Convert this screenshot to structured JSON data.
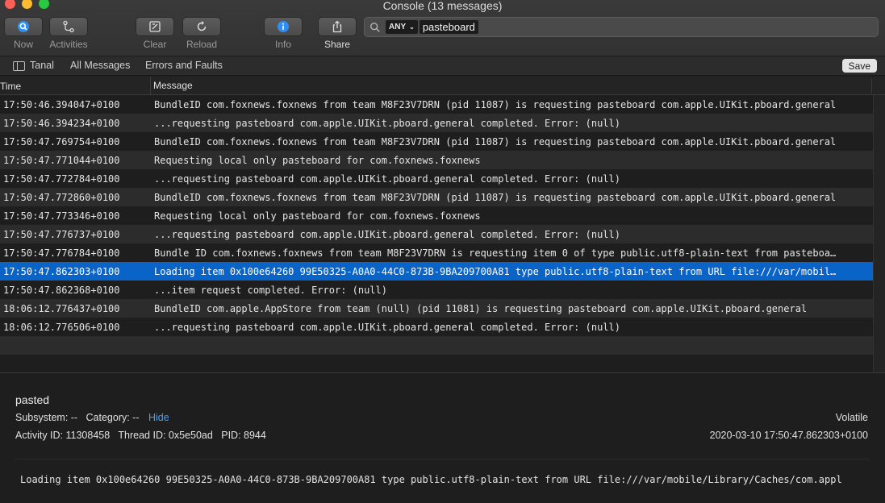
{
  "window": {
    "title": "Console (13 messages)"
  },
  "toolbar": {
    "now_label": "Now",
    "activities_label": "Activities",
    "clear_label": "Clear",
    "reload_label": "Reload",
    "info_label": "Info",
    "share_label": "Share"
  },
  "search": {
    "scope": "ANY",
    "token": "pasteboard"
  },
  "filterbar": {
    "sidebar_label": "Tanal",
    "all_messages": "All Messages",
    "errors_faults": "Errors and Faults",
    "save_label": "Save"
  },
  "table": {
    "col_time": "Time",
    "col_message": "Message",
    "rows": [
      {
        "time": "17:50:46.394047+0100",
        "message": "BundleID com.foxnews.foxnews from team M8F23V7DRN (pid 11087) is requesting pasteboard com.apple.UIKit.pboard.general"
      },
      {
        "time": "17:50:46.394234+0100",
        "message": "...requesting pasteboard com.apple.UIKit.pboard.general completed. Error: (null)"
      },
      {
        "time": "17:50:47.769754+0100",
        "message": "BundleID com.foxnews.foxnews from team M8F23V7DRN (pid 11087) is requesting pasteboard com.apple.UIKit.pboard.general"
      },
      {
        "time": "17:50:47.771044+0100",
        "message": "Requesting local only pasteboard for com.foxnews.foxnews"
      },
      {
        "time": "17:50:47.772784+0100",
        "message": "...requesting pasteboard com.apple.UIKit.pboard.general completed. Error: (null)"
      },
      {
        "time": "17:50:47.772860+0100",
        "message": "BundleID com.foxnews.foxnews from team M8F23V7DRN (pid 11087) is requesting pasteboard com.apple.UIKit.pboard.general"
      },
      {
        "time": "17:50:47.773346+0100",
        "message": "Requesting local only pasteboard for com.foxnews.foxnews"
      },
      {
        "time": "17:50:47.776737+0100",
        "message": "...requesting pasteboard com.apple.UIKit.pboard.general completed. Error: (null)"
      },
      {
        "time": "17:50:47.776784+0100",
        "message": "Bundle ID com.foxnews.foxnews from team M8F23V7DRN is requesting item 0 of type public.utf8-plain-text from pasteboa…"
      },
      {
        "time": "17:50:47.862303+0100",
        "message": "Loading item 0x100e64260 99E50325-A0A0-44C0-873B-9BA209700A81 type public.utf8-plain-text from URL file:///var/mobil…",
        "selected": true
      },
      {
        "time": "17:50:47.862368+0100",
        "message": "...item request completed. Error: (null)"
      },
      {
        "time": "18:06:12.776437+0100",
        "message": "BundleID com.apple.AppStore from team (null) (pid 11081) is requesting pasteboard com.apple.UIKit.pboard.general"
      },
      {
        "time": "18:06:12.776506+0100",
        "message": "...requesting pasteboard com.apple.UIKit.pboard.general completed. Error: (null)"
      }
    ]
  },
  "detail": {
    "process": "pasted",
    "subsystem_text": "Subsystem: --   Category: --",
    "hide_link": "Hide",
    "ids_text": "Activity ID: 11308458   Thread ID: 0x5e50ad   PID: 8944",
    "level": "Volatile",
    "timestamp": "2020-03-10 17:50:47.862303+0100",
    "message": "Loading item 0x100e64260 99E50325-A0A0-44C0-873B-9BA209700A81 type public.utf8-plain-text from URL file:///var/mobile/Library/Caches/com.appl"
  }
}
